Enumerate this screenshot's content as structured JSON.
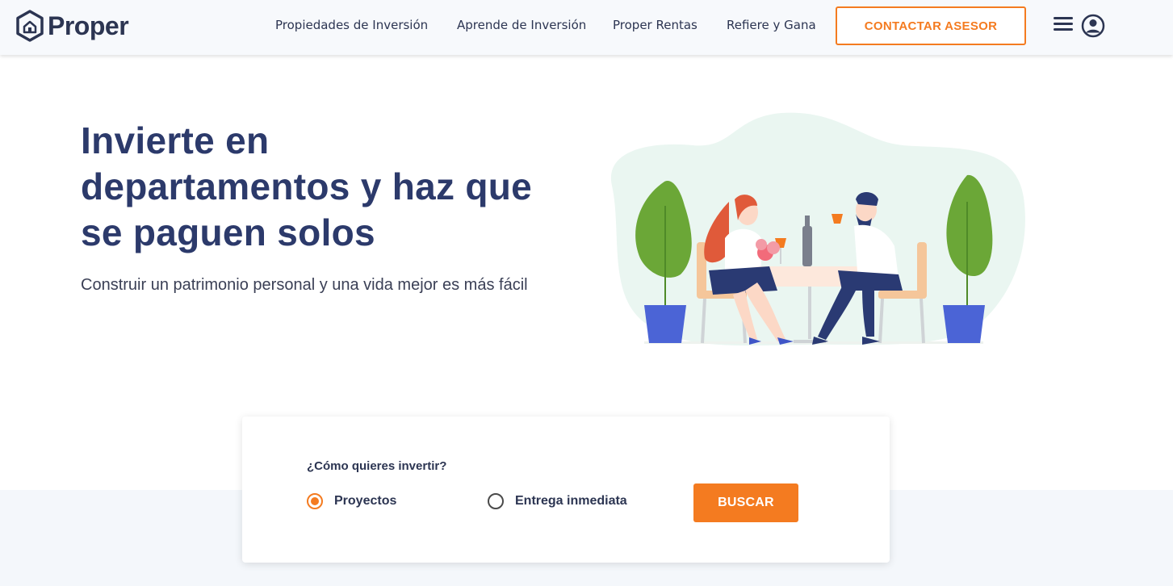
{
  "header": {
    "brand": "Proper",
    "nav": [
      {
        "label": "Propiedades de Inversión"
      },
      {
        "label": "Aprende de Inversión"
      },
      {
        "label": "Proper Rentas"
      },
      {
        "label": "Refiere y Gana"
      }
    ],
    "cta_label": "CONTACTAR ASESOR",
    "icons": [
      "menu-icon",
      "user-icon"
    ]
  },
  "hero": {
    "title": "Invierte en departamentos y haz que se paguen solos",
    "subtitle": "Construir un patrimonio personal y una vida mejor es más fácil"
  },
  "search": {
    "question": "¿Cómo quieres invertir?",
    "options": [
      {
        "label": "Proyectos",
        "selected": true
      },
      {
        "label": "Entrega inmediata",
        "selected": false
      }
    ],
    "button_label": "BUSCAR"
  },
  "colors": {
    "accent": "#f47b20",
    "navy": "#2c3a6b",
    "text": "#2c3552"
  }
}
